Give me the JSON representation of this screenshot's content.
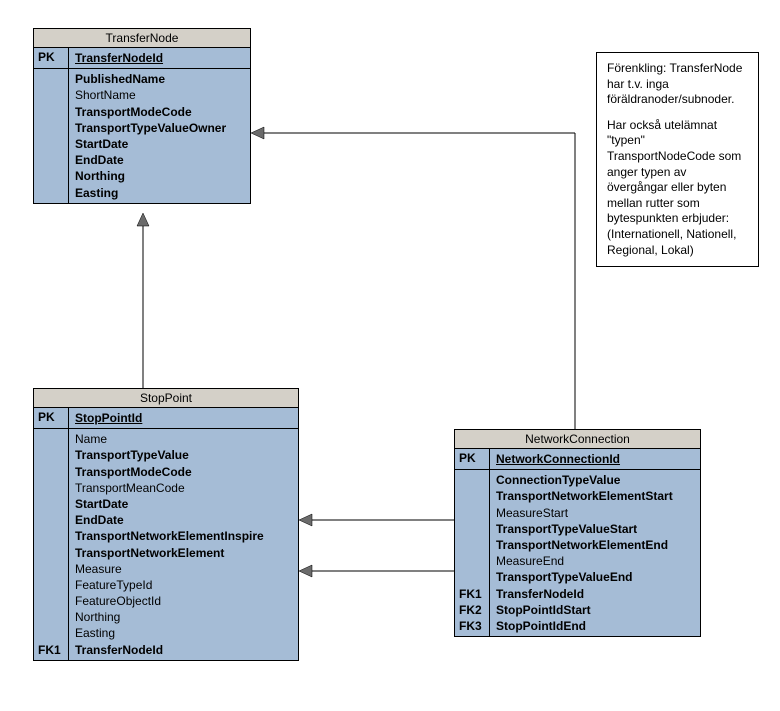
{
  "entities": {
    "transferNode": {
      "title": "TransferNode",
      "pk": {
        "key": "PK",
        "name": "TransferNodeId"
      },
      "attrs": [
        {
          "name": "PublishedName",
          "bold": true
        },
        {
          "name": "ShortName",
          "bold": false
        },
        {
          "name": "TransportModeCode",
          "bold": true
        },
        {
          "name": "TransportTypeValueOwner",
          "bold": true
        },
        {
          "name": "StartDate",
          "bold": true
        },
        {
          "name": "EndDate",
          "bold": true
        },
        {
          "name": "Northing",
          "bold": true
        },
        {
          "name": "Easting",
          "bold": true
        }
      ],
      "fkLabels": []
    },
    "stopPoint": {
      "title": "StopPoint",
      "pk": {
        "key": "PK",
        "name": "StopPointId"
      },
      "attrs": [
        {
          "name": "Name",
          "bold": false
        },
        {
          "name": "TransportTypeValue",
          "bold": true
        },
        {
          "name": "TransportModeCode",
          "bold": true
        },
        {
          "name": "TransportMeanCode",
          "bold": false
        },
        {
          "name": "StartDate",
          "bold": true
        },
        {
          "name": "EndDate",
          "bold": true
        },
        {
          "name": "TransportNetworkElementInspire",
          "bold": true
        },
        {
          "name": "TransportNetworkElement",
          "bold": true
        },
        {
          "name": "Measure",
          "bold": false
        },
        {
          "name": "FeatureTypeId",
          "bold": false
        },
        {
          "name": "FeatureObjectId",
          "bold": false
        },
        {
          "name": "Northing",
          "bold": false
        },
        {
          "name": "Easting",
          "bold": false
        },
        {
          "name": "TransferNodeId",
          "bold": true
        }
      ],
      "fkLabels": [
        "",
        "",
        "",
        "",
        "",
        "",
        "",
        "",
        "",
        "",
        "",
        "",
        "",
        "FK1"
      ]
    },
    "networkConnection": {
      "title": "NetworkConnection",
      "pk": {
        "key": "PK",
        "name": "NetworkConnectionId"
      },
      "attrs": [
        {
          "name": "ConnectionTypeValue",
          "bold": true
        },
        {
          "name": "TransportNetworkElementStart",
          "bold": true
        },
        {
          "name": "MeasureStart",
          "bold": false
        },
        {
          "name": "TransportTypeValueStart",
          "bold": true
        },
        {
          "name": "TransportNetworkElementEnd",
          "bold": true
        },
        {
          "name": "MeasureEnd",
          "bold": false
        },
        {
          "name": "TransportTypeValueEnd",
          "bold": true
        },
        {
          "name": "TransferNodeId",
          "bold": true
        },
        {
          "name": "StopPointIdStart",
          "bold": true
        },
        {
          "name": "StopPointIdEnd",
          "bold": true
        }
      ],
      "fkLabels": [
        "",
        "",
        "",
        "",
        "",
        "",
        "",
        "FK1",
        "FK2",
        "FK3"
      ]
    }
  },
  "note": {
    "p1": "Förenkling: TransferNode har t.v. inga föräldranoder/subnoder.",
    "p2": "Har också utelämnat \"typen\" TransportNodeCode som anger typen av övergångar eller byten mellan  rutter som bytespunkten erbjuder: (Internationell, Nationell, Regional, Lokal)"
  }
}
